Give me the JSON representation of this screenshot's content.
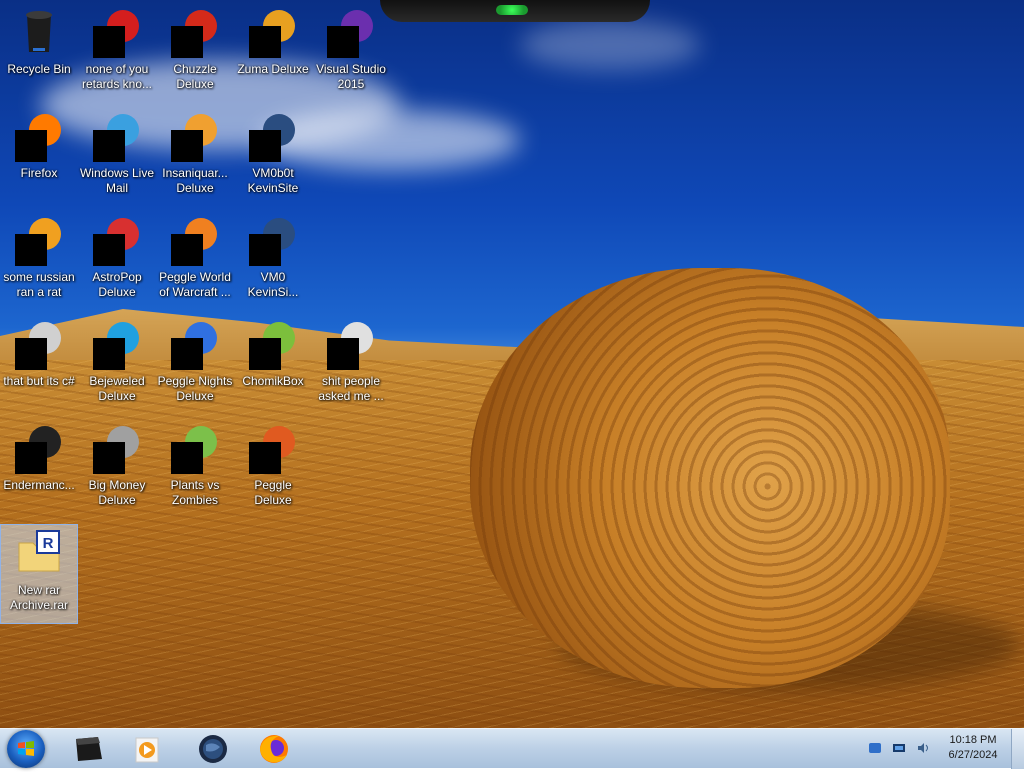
{
  "desktop": {
    "icons": [
      {
        "id": "recycle-bin",
        "label": "Recycle Bin",
        "icon": "recycle-bin-icon"
      },
      {
        "id": "none-of-you",
        "label": "none of you retards kno...",
        "icon": "red-app-icon"
      },
      {
        "id": "chuzzle",
        "label": "Chuzzle Deluxe",
        "icon": "chuzzle-icon"
      },
      {
        "id": "zuma",
        "label": "Zuma Deluxe",
        "icon": "zuma-icon"
      },
      {
        "id": "visual-studio",
        "label": "Visual Studio 2015",
        "icon": "visual-studio-icon"
      },
      {
        "id": "firefox",
        "label": "Firefox",
        "icon": "firefox-icon"
      },
      {
        "id": "windows-live-mail",
        "label": "Windows Live Mail",
        "icon": "mail-icon"
      },
      {
        "id": "insaniquarium",
        "label": "Insaniquar... Deluxe",
        "icon": "insaniquarium-icon"
      },
      {
        "id": "vm0b0t",
        "label": "VM0b0t KevinSite",
        "icon": "website-icon"
      },
      {
        "id": "some-russian",
        "label": "some russian ran a rat",
        "icon": "jar-file-icon"
      },
      {
        "id": "astropop",
        "label": "AstroPop Deluxe",
        "icon": "astropop-icon"
      },
      {
        "id": "peggle-wow",
        "label": "Peggle World of Warcraft ...",
        "icon": "peggle-wow-icon"
      },
      {
        "id": "vm0-kevinsi",
        "label": "VM0 KevinSi...",
        "icon": "website-icon"
      },
      {
        "id": "that-but-c",
        "label": "that but its c#",
        "icon": "copy-icon"
      },
      {
        "id": "bejeweled",
        "label": "Bejeweled Deluxe",
        "icon": "bejeweled-icon"
      },
      {
        "id": "peggle-nights",
        "label": "Peggle Nights Deluxe",
        "icon": "peggle-nights-icon"
      },
      {
        "id": "chomikbox",
        "label": "ChomikBox",
        "icon": "chomikbox-icon"
      },
      {
        "id": "shit-people",
        "label": "shit people asked me ...",
        "icon": "folder-icon"
      },
      {
        "id": "endermanch",
        "label": "Endermanc...",
        "icon": "shortcut-icon"
      },
      {
        "id": "big-money",
        "label": "Big Money Deluxe",
        "icon": "big-money-icon"
      },
      {
        "id": "pvz",
        "label": "Plants vs Zombies",
        "icon": "plants-vs-zombies-icon"
      },
      {
        "id": "peggle-deluxe",
        "label": "Peggle Deluxe",
        "icon": "peggle-icon"
      },
      {
        "id": "new-rar",
        "label": "New rar Archive.rar",
        "icon": "rar-archive-icon",
        "selected": true
      }
    ]
  },
  "taskbar": {
    "start_icon": "windows-start-icon",
    "pinned": [
      {
        "id": "cmd",
        "icon": "terminal-icon"
      },
      {
        "id": "media",
        "icon": "media-player-icon"
      },
      {
        "id": "globe",
        "icon": "globe-icon"
      },
      {
        "id": "firefox",
        "icon": "firefox-icon"
      }
    ],
    "tray": [
      {
        "id": "tray-1",
        "icon": "tray-app-icon"
      },
      {
        "id": "tray-2",
        "icon": "network-icon"
      },
      {
        "id": "tray-3",
        "icon": "volume-icon"
      }
    ],
    "clock": {
      "time": "10:18 PM",
      "date": "6/27/2024"
    }
  },
  "colors": {
    "taskbar": "#bcd0e6",
    "selection": "#c8e1ff"
  }
}
